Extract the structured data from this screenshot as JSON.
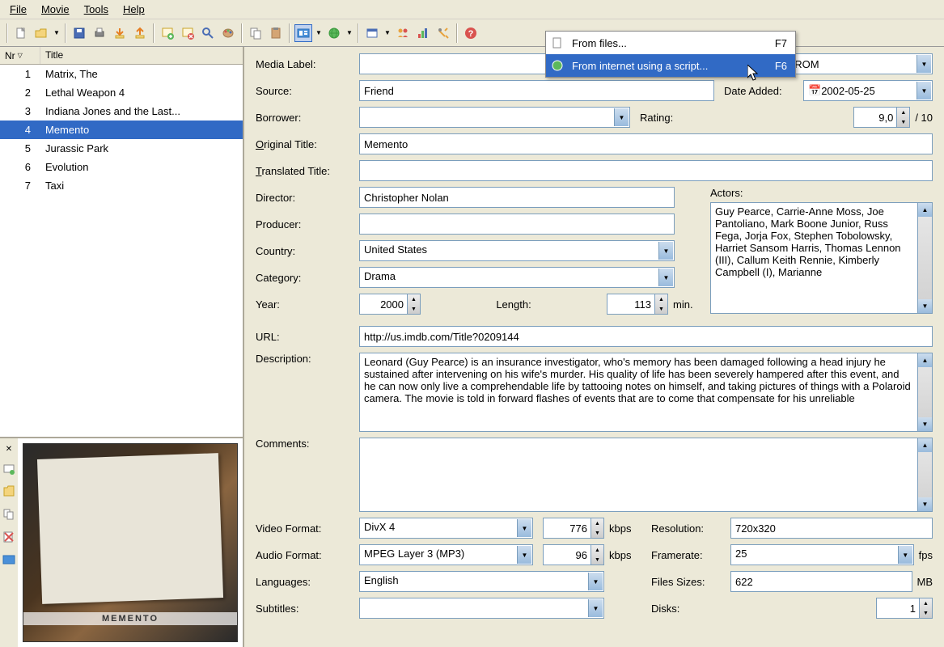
{
  "menu": {
    "file": "File",
    "movie": "Movie",
    "tools": "Tools",
    "help": "Help"
  },
  "list": {
    "col_nr": "Nr",
    "col_title": "Title",
    "rows": [
      {
        "nr": "1",
        "title": "Matrix, The"
      },
      {
        "nr": "2",
        "title": "Lethal Weapon 4"
      },
      {
        "nr": "3",
        "title": "Indiana Jones and the Last..."
      },
      {
        "nr": "4",
        "title": "Memento"
      },
      {
        "nr": "5",
        "title": "Jurassic Park"
      },
      {
        "nr": "6",
        "title": "Evolution"
      },
      {
        "nr": "7",
        "title": "Taxi"
      }
    ],
    "selected_index": 3
  },
  "poster": {
    "caption": "MEMENTO"
  },
  "form": {
    "media_label": {
      "label": "Media Label:",
      "value": ""
    },
    "media_type": {
      "value": "CD-ROM"
    },
    "source": {
      "label": "Source:",
      "value": "Friend"
    },
    "date_added": {
      "label": "Date Added:",
      "value": "2002-05-25"
    },
    "borrower": {
      "label": "Borrower:",
      "value": ""
    },
    "rating": {
      "label": "Rating:",
      "value": "9,0",
      "suffix": "/ 10"
    },
    "original_title": {
      "label": "Original Title:",
      "value": "Memento"
    },
    "translated_title": {
      "label": "Translated Title:",
      "value": ""
    },
    "director": {
      "label": "Director:",
      "value": "Christopher Nolan"
    },
    "producer": {
      "label": "Producer:",
      "value": ""
    },
    "country": {
      "label": "Country:",
      "value": "United States"
    },
    "category": {
      "label": "Category:",
      "value": "Drama"
    },
    "year": {
      "label": "Year:",
      "value": "2000"
    },
    "length": {
      "label": "Length:",
      "value": "113",
      "unit": "min."
    },
    "actors": {
      "label": "Actors:",
      "value": "Guy Pearce, Carrie-Anne Moss, Joe Pantoliano, Mark Boone Junior, Russ Fega, Jorja Fox, Stephen Tobolowsky, Harriet Sansom Harris, Thomas Lennon (III), Callum Keith Rennie, Kimberly Campbell (I), Marianne"
    },
    "url": {
      "label": "URL:",
      "value": "http://us.imdb.com/Title?0209144"
    },
    "description": {
      "label": "Description:",
      "value": "Leonard (Guy Pearce) is an insurance investigator, who's memory has been damaged following a head injury he sustained after intervening on his wife's murder. His quality of life has been severely hampered after this event, and he can now only live a comprehendable life by tattooing notes on himself, and taking pictures of things with a Polaroid camera. The movie is told in forward flashes of events that are to come that compensate for his unreliable"
    },
    "comments": {
      "label": "Comments:",
      "value": ""
    },
    "video_format": {
      "label": "Video Format:",
      "value": "DivX 4",
      "bitrate": "776",
      "unit": "kbps"
    },
    "resolution": {
      "label": "Resolution:",
      "value": "720x320"
    },
    "audio_format": {
      "label": "Audio Format:",
      "value": "MPEG Layer 3 (MP3)",
      "bitrate": "96",
      "unit": "kbps"
    },
    "framerate": {
      "label": "Framerate:",
      "value": "25",
      "unit": "fps"
    },
    "languages": {
      "label": "Languages:",
      "value": "English"
    },
    "file_sizes": {
      "label": "Files Sizes:",
      "value": "622",
      "unit": "MB"
    },
    "subtitles": {
      "label": "Subtitles:",
      "value": ""
    },
    "disks": {
      "label": "Disks:",
      "value": "1"
    }
  },
  "dropdown": {
    "item1": {
      "label": "From files...",
      "shortcut": "F7"
    },
    "item2": {
      "label": "From internet using a script...",
      "shortcut": "F6"
    }
  }
}
